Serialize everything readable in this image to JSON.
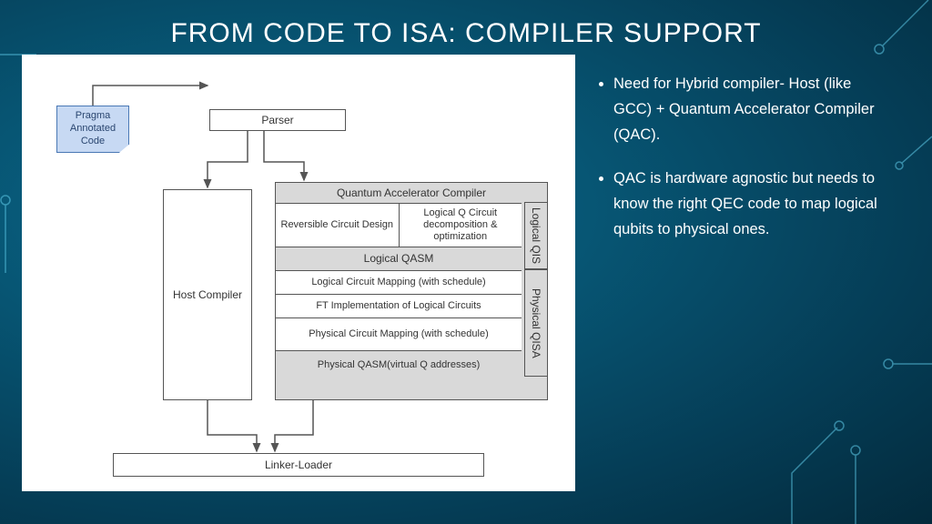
{
  "title": "FROM CODE TO ISA: COMPILER SUPPORT",
  "diagram": {
    "note": "Pragma Annotated Code",
    "parser": "Parser",
    "host": "Host Compiler",
    "qac_title": "Quantum Accelerator Compiler",
    "rev": "Reversible Circuit Design",
    "decomp": "Logical Q Circuit decomposition & optimization",
    "lqasm": "Logical QASM",
    "lmap": "Logical Circuit Mapping (with schedule)",
    "ft": "FT Implementation of Logical Circuits",
    "pmap": "Physical Circuit Mapping (with schedule)",
    "pqasm": "Physical QASM(virtual Q addresses)",
    "lqisa": "Logical QIS",
    "pqisa": "Physical QISA",
    "linker": "Linker-Loader"
  },
  "bullets": [
    "Need for Hybrid compiler- Host (like GCC) + Quantum Accelerator Compiler (QAC).",
    "QAC is hardware agnostic but needs to know the right QEC code to map logical qubits to physical ones."
  ]
}
